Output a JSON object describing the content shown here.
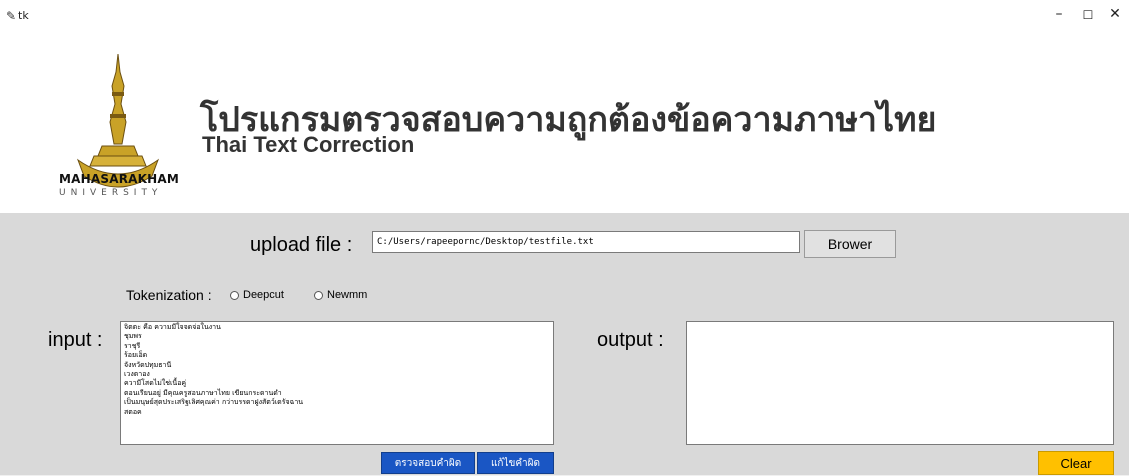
{
  "window": {
    "title": "tk",
    "minimize": "–",
    "maximize": "☐",
    "close": "✕"
  },
  "header": {
    "title_thai": "โปรแกรมตรวจสอบความถูกต้องข้อความภาษาไทย",
    "title_english": "Thai Text Correction",
    "logo_name": "MAHASARAKHAM",
    "logo_sub": "UNIVERSITY"
  },
  "upload": {
    "label": "upload file :",
    "path": "C:/Users/rapeepornc/Desktop/testfile.txt",
    "browse_button": "Brower"
  },
  "tokenization": {
    "label": "Tokenization :",
    "options": [
      "Deepcut",
      "Newmm"
    ]
  },
  "input": {
    "label": "input :",
    "lines": [
      "จิตตะ คือ ความมีใจจดจ่อในงาน",
      "ชุมพร",
      "ราชุรี",
      "ร้อยเอ็ด",
      "จังหวัดปทุมธานี",
      "เวงตาอง",
      "ความีโสดไม่ใช่เนื้อคู่",
      "ตอนเรียนอยู่ มีคุณครูสอนภาษาไทย เขียนกระดานดำ",
      "เป็นมนุษย์สุดประเสริฐเลิศคุณค่า กว่าบรรดาฝูงสัตว์เดรัจฉาน",
      "สตอค"
    ]
  },
  "output": {
    "label": "output :"
  },
  "buttons": {
    "check": "ตรวจสอบคำผิด",
    "fix": "แก้ไขคำผิด",
    "clear": "Clear"
  },
  "colors": {
    "panel_bg": "#d9d9d9",
    "button_blue": "#1a56c4",
    "button_clear": "#ffc000",
    "logo_gold": "#c9a227"
  }
}
